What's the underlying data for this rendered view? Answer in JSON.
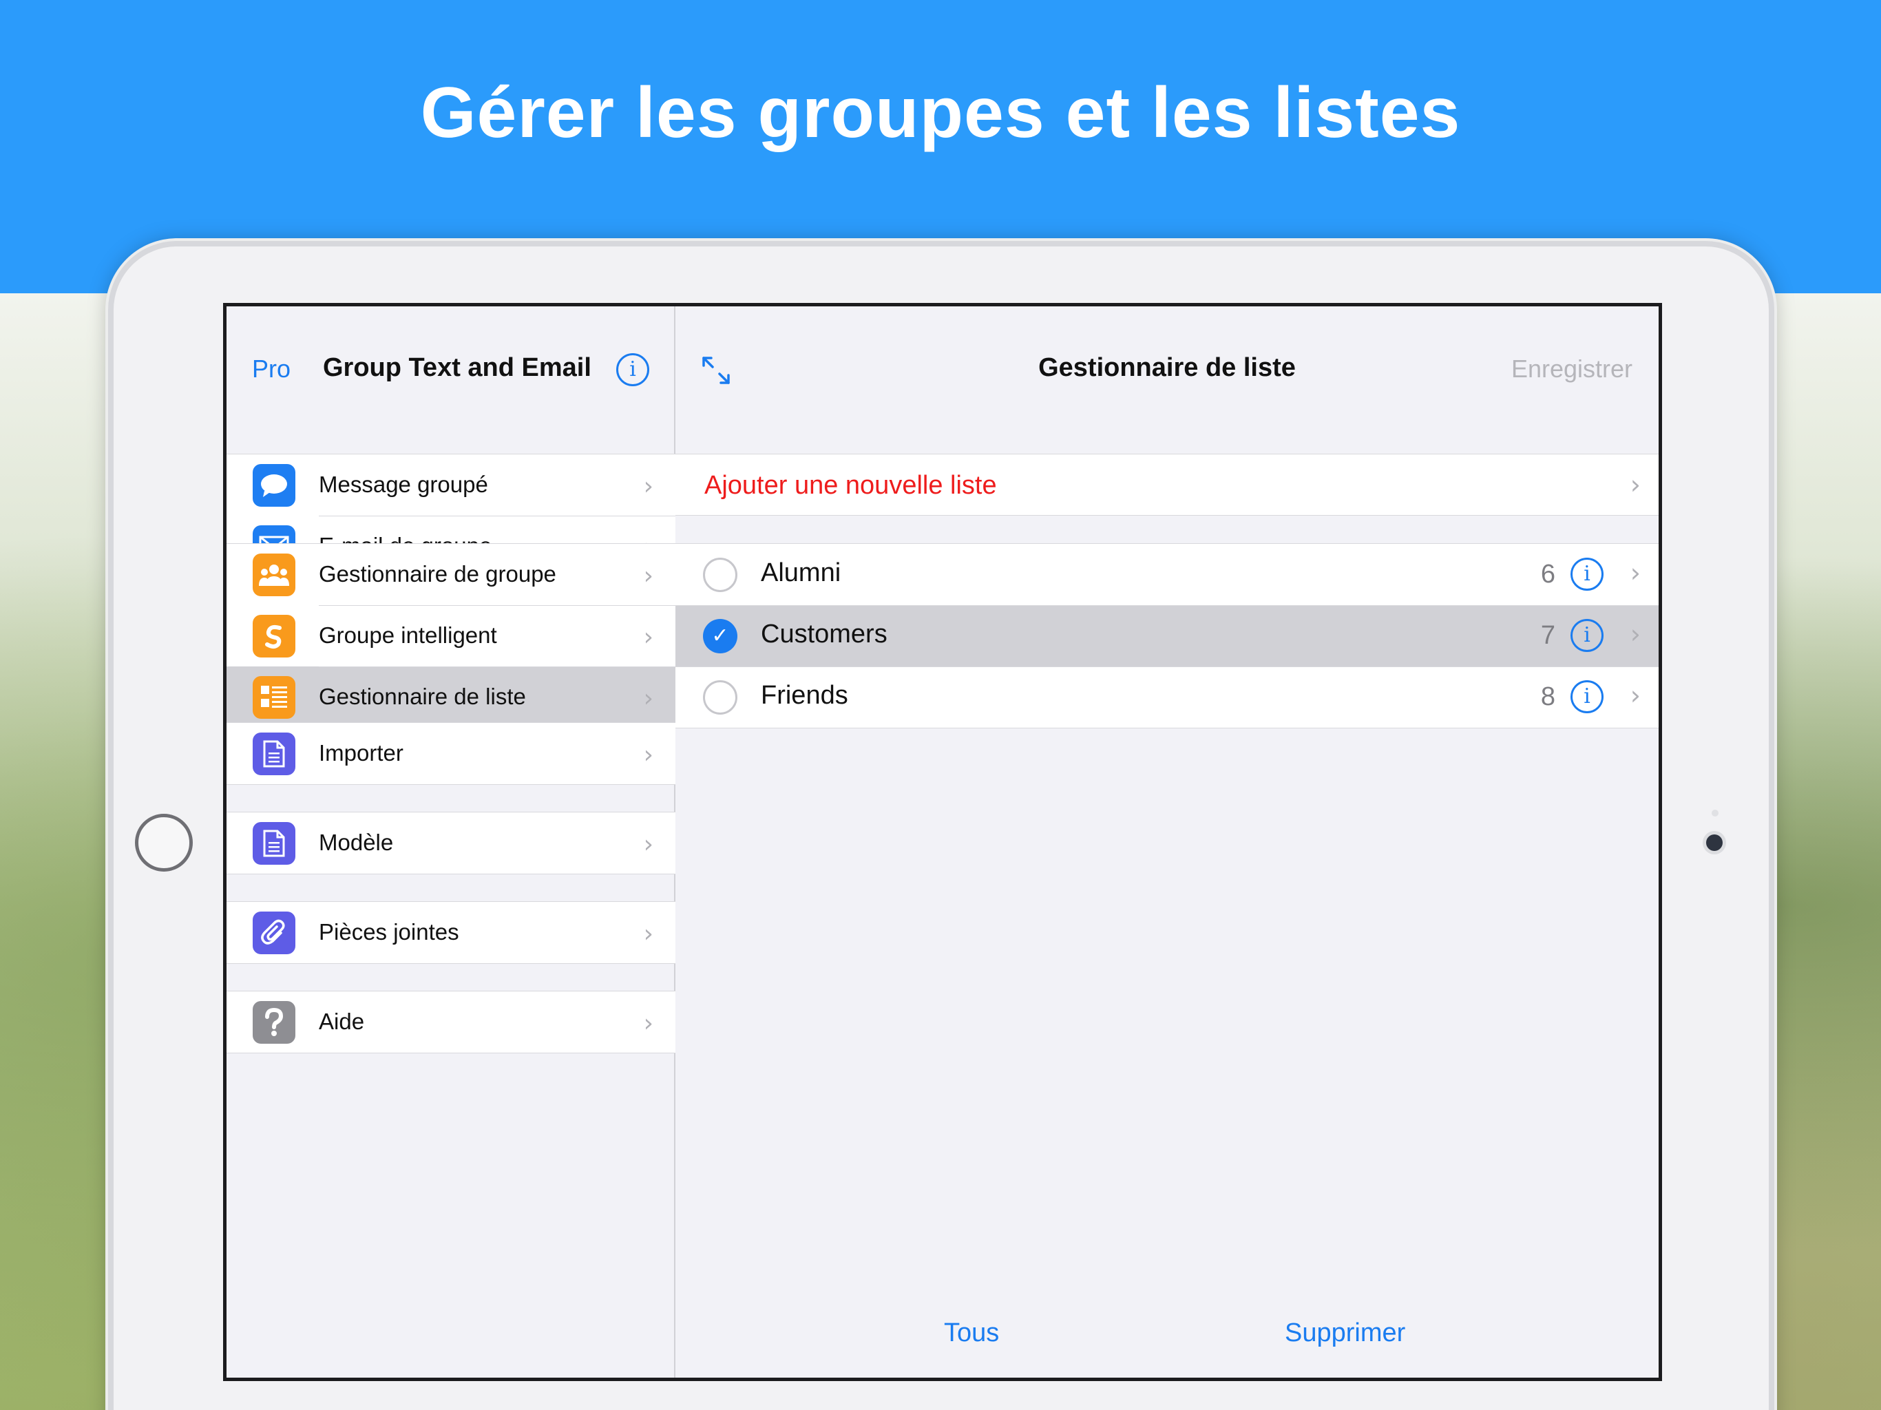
{
  "headline": "Gérer les groupes et les listes",
  "sidebar": {
    "pro_label": "Pro",
    "title": "Group Text and Email",
    "info_glyph": "i",
    "groups": [
      [
        {
          "label": "Message groupé",
          "icon": "message-bubble-icon",
          "color": "#1e7ef2"
        },
        {
          "label": "E-mail de groupe",
          "icon": "envelope-icon",
          "color": "#1e7ef2"
        }
      ],
      [
        {
          "label": "Gestionnaire de groupe",
          "icon": "people-icon",
          "color": "#f99a1c"
        },
        {
          "label": "Groupe intelligent",
          "icon": "smart-s-icon",
          "color": "#f99a1c"
        },
        {
          "label": "Gestionnaire de liste",
          "icon": "list-icon",
          "color": "#f99a1c",
          "selected": true
        }
      ],
      [
        {
          "label": "Importer",
          "icon": "document-icon",
          "color": "#5e5ce6"
        }
      ],
      [
        {
          "label": "Modèle",
          "icon": "document-icon",
          "color": "#5e5ce6"
        }
      ],
      [
        {
          "label": "Pièces jointes",
          "icon": "paperclip-icon",
          "color": "#5e5ce6"
        }
      ],
      [
        {
          "label": "Aide",
          "icon": "question-icon",
          "color": "#8e8e93"
        }
      ]
    ]
  },
  "detail": {
    "title": "Gestionnaire de liste",
    "save_label": "Enregistrer",
    "add_list_label": "Ajouter une nouvelle liste",
    "lists": [
      {
        "name": "Alumni",
        "count": "6",
        "checked": false
      },
      {
        "name": "Customers",
        "count": "7",
        "checked": true
      },
      {
        "name": "Friends",
        "count": "8",
        "checked": false
      }
    ],
    "all_label": "Tous",
    "delete_label": "Supprimer"
  },
  "colors": {
    "banner": "#2b9bfb",
    "accent": "#1a7cf0",
    "destructive": "#ee1c1c"
  }
}
